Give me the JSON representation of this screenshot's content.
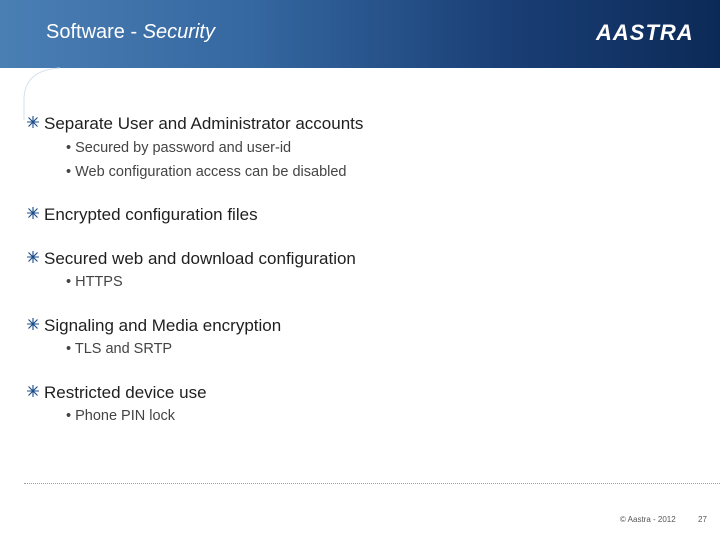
{
  "header": {
    "title_main": "Software - ",
    "title_italic": "Security",
    "logo_text": "AASTRA"
  },
  "bullets": [
    {
      "text": "Separate User and Administrator accounts",
      "subs": [
        "• Secured by password and user-id",
        "• Web configuration access can be disabled"
      ]
    },
    {
      "text": "Encrypted configuration files",
      "subs": []
    },
    {
      "text": "Secured web and download configuration",
      "subs": [
        "• HTTPS"
      ]
    },
    {
      "text": "Signaling and Media encryption",
      "subs": [
        "• TLS and SRTP"
      ]
    },
    {
      "text": "Restricted device use",
      "subs": [
        "• Phone PIN lock"
      ]
    }
  ],
  "footer": {
    "copyright": "© Aastra - 2012",
    "page_number": "27"
  },
  "colors": {
    "header_start": "#4a7fb4",
    "header_end": "#0c2a57",
    "bullet_star": "#1a4c8a"
  }
}
